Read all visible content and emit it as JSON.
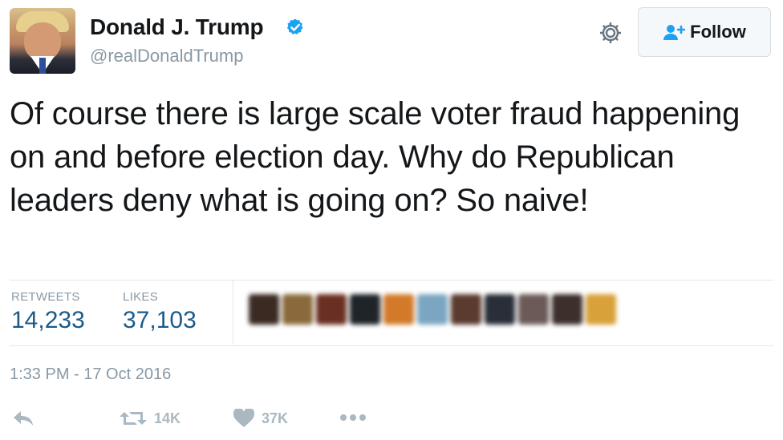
{
  "tweet": {
    "author": {
      "name": "Donald J. Trump",
      "handle": "@realDonaldTrump",
      "verified": true
    },
    "follow_label": "Follow",
    "text": "Of course there is large scale voter fraud happening on and before election day. Why do Republican leaders deny what is going on? So naive!",
    "stats": {
      "retweets_label": "RETWEETS",
      "retweets_value": "14,233",
      "likes_label": "LIKES",
      "likes_value": "37,103"
    },
    "timestamp": "1:33 PM - 17 Oct 2016",
    "actions": {
      "retweet_count": "14K",
      "like_count": "37K"
    }
  },
  "liker_avatars": [
    {
      "icon": "blurred-avatar",
      "color": "#3a2a22"
    },
    {
      "icon": "blurred-avatar",
      "color": "#8a6a3c"
    },
    {
      "icon": "blurred-avatar",
      "color": "#6a2f22"
    },
    {
      "icon": "blurred-avatar",
      "color": "#1f2428"
    },
    {
      "icon": "blurred-avatar",
      "color": "#d27a2a"
    },
    {
      "icon": "blurred-avatar",
      "color": "#7aa6c2"
    },
    {
      "icon": "blurred-avatar",
      "color": "#5a3b2e"
    },
    {
      "icon": "blurred-avatar",
      "color": "#2a2e38"
    },
    {
      "icon": "blurred-avatar",
      "color": "#6b5a58"
    },
    {
      "icon": "blurred-avatar",
      "color": "#3c2f2c"
    },
    {
      "icon": "blurred-avatar",
      "color": "#d8a13a"
    }
  ],
  "colors": {
    "verified_blue": "#1da1f2",
    "follow_icon_blue": "#1da1f2",
    "stat_value": "#1a5b8a",
    "muted_gray": "#8899a6",
    "action_gray": "#aab8c2"
  }
}
